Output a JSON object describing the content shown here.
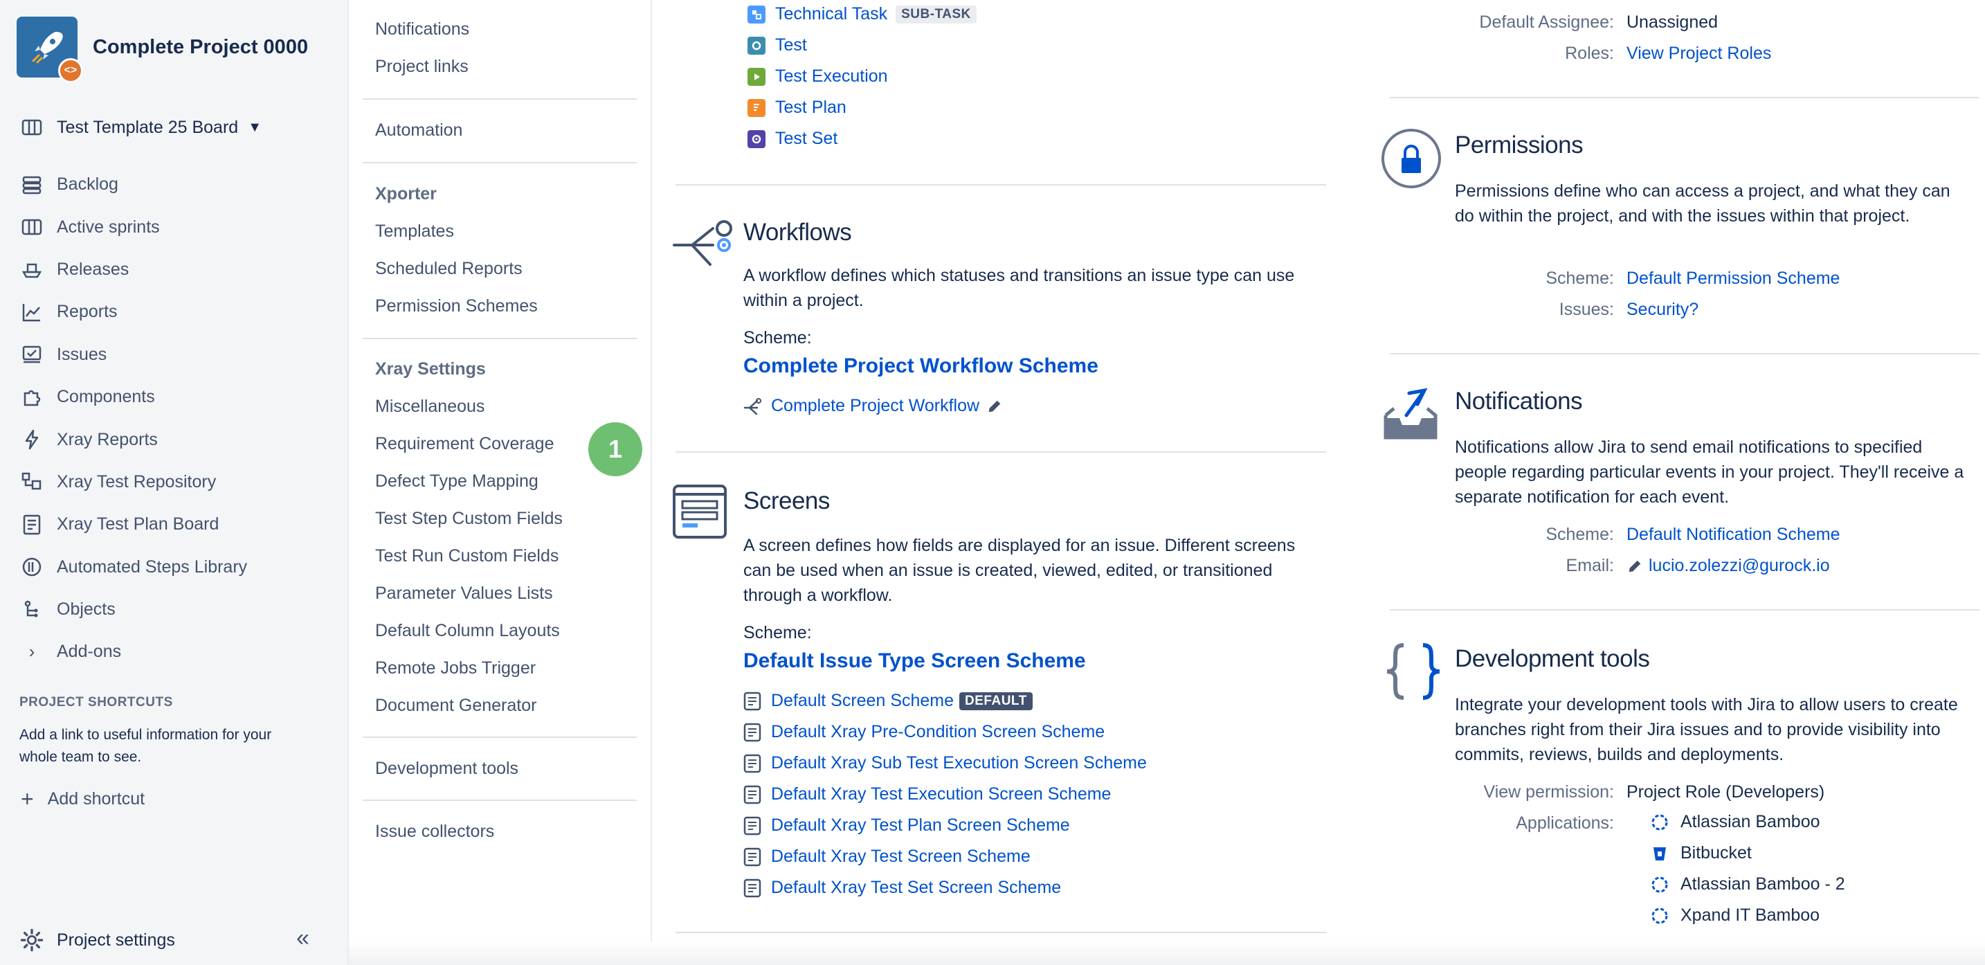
{
  "sidebar": {
    "project_name": "Complete Project 0000",
    "board": "Test Template 25 Board",
    "nav": [
      {
        "label": "Backlog",
        "icon": "backlog-icon"
      },
      {
        "label": "Active sprints",
        "icon": "board-icon"
      },
      {
        "label": "Releases",
        "icon": "ship-icon"
      },
      {
        "label": "Reports",
        "icon": "chart-icon"
      },
      {
        "label": "Issues",
        "icon": "issues-icon"
      },
      {
        "label": "Components",
        "icon": "puzzle-icon"
      },
      {
        "label": "Xray Reports",
        "icon": "bolt-icon"
      },
      {
        "label": "Xray Test Repository",
        "icon": "repository-icon"
      },
      {
        "label": "Xray Test Plan Board",
        "icon": "plan-board-icon"
      },
      {
        "label": "Automated Steps Library",
        "icon": "library-icon"
      },
      {
        "label": "Objects",
        "icon": "objects-icon"
      },
      {
        "label": "Add-ons",
        "icon": "chevron-right-icon"
      }
    ],
    "shortcuts_title": "PROJECT SHORTCUTS",
    "shortcuts_desc": "Add a link to useful information for your whole team to see.",
    "add_shortcut": "Add shortcut",
    "project_settings": "Project settings"
  },
  "subnav": {
    "top_items": [
      "Notifications",
      "Project links"
    ],
    "automation": "Automation",
    "xporter_heading": "Xporter",
    "xporter_items": [
      "Templates",
      "Scheduled Reports",
      "Permission Schemes"
    ],
    "xray_heading": "Xray Settings",
    "xray_items": [
      "Miscellaneous",
      "Requirement Coverage",
      "Defect Type Mapping",
      "Test Step Custom Fields",
      "Test Run Custom Fields",
      "Parameter Values Lists",
      "Default Column Layouts",
      "Remote Jobs Trigger",
      "Document Generator"
    ],
    "dev_tools": "Development tools",
    "issue_collectors": "Issue collectors",
    "step_badge": "1"
  },
  "issue_types": [
    {
      "label": "Technical Task",
      "badge": "SUB-TASK",
      "color": "#4c9aff"
    },
    {
      "label": "Test",
      "badge": "",
      "color": "#3b8db0"
    },
    {
      "label": "Test Execution",
      "badge": "",
      "color": "#6ea93a"
    },
    {
      "label": "Test Plan",
      "badge": "",
      "color": "#f38b2c"
    },
    {
      "label": "Test Set",
      "badge": "",
      "color": "#5243aa"
    }
  ],
  "workflows": {
    "title": "Workflows",
    "desc": "A workflow defines which statuses and transitions an issue type can use within a project.",
    "scheme_label": "Scheme:",
    "scheme_name": "Complete Project Workflow Scheme",
    "workflow": "Complete Project Workflow"
  },
  "screens": {
    "title": "Screens",
    "desc": "A screen defines how fields are displayed for an issue. Different screens can be used when an issue is created, viewed, edited, or transitioned through a workflow.",
    "scheme_label": "Scheme:",
    "scheme_name": "Default Issue Type Screen Scheme",
    "items": [
      {
        "label": "Default Screen Scheme",
        "badge": "DEFAULT"
      },
      {
        "label": "Default Xray Pre-Condition Screen Scheme",
        "badge": ""
      },
      {
        "label": "Default Xray Sub Test Execution Screen Scheme",
        "badge": ""
      },
      {
        "label": "Default Xray Test Execution Screen Scheme",
        "badge": ""
      },
      {
        "label": "Default Xray Test Plan Screen Scheme",
        "badge": ""
      },
      {
        "label": "Default Xray Test Screen Scheme",
        "badge": ""
      },
      {
        "label": "Default Xray Test Set Screen Scheme",
        "badge": ""
      }
    ]
  },
  "people": {
    "default_assignee_label": "Default Assignee:",
    "default_assignee": "Unassigned",
    "roles_label": "Roles:",
    "roles_link": "View Project Roles"
  },
  "permissions": {
    "title": "Permissions",
    "desc": "Permissions define who can access a project, and what they can do within the project, and with the issues within that project.",
    "scheme_label": "Scheme:",
    "scheme": "Default Permission Scheme",
    "issues_label": "Issues:",
    "issues": "Security?"
  },
  "notifications": {
    "title": "Notifications",
    "desc": "Notifications allow Jira to send email notifications to specified people regarding particular events in your project. They'll receive a separate notification for each event.",
    "scheme_label": "Scheme:",
    "scheme": "Default Notification Scheme",
    "email_label": "Email:",
    "email": "lucio.zolezzi@gurock.io"
  },
  "devtools": {
    "title": "Development tools",
    "desc": "Integrate your development tools with Jira to allow users to create branches right from their Jira issues and to provide visibility into commits, reviews, builds and deployments.",
    "view_permission_label": "View permission:",
    "view_permission": "Project Role (Developers)",
    "applications_label": "Applications:",
    "applications": [
      {
        "label": "Atlassian Bamboo",
        "icon": "bamboo-icon"
      },
      {
        "label": "Bitbucket",
        "icon": "bitbucket-icon"
      },
      {
        "label": "Atlassian Bamboo - 2",
        "icon": "bamboo-icon"
      },
      {
        "label": "Xpand IT Bamboo",
        "icon": "bamboo-icon"
      }
    ]
  },
  "colors": {
    "link": "#0052cc",
    "text": "#172b4d",
    "muted": "#5e6c84",
    "badge": "#6fbf73"
  }
}
